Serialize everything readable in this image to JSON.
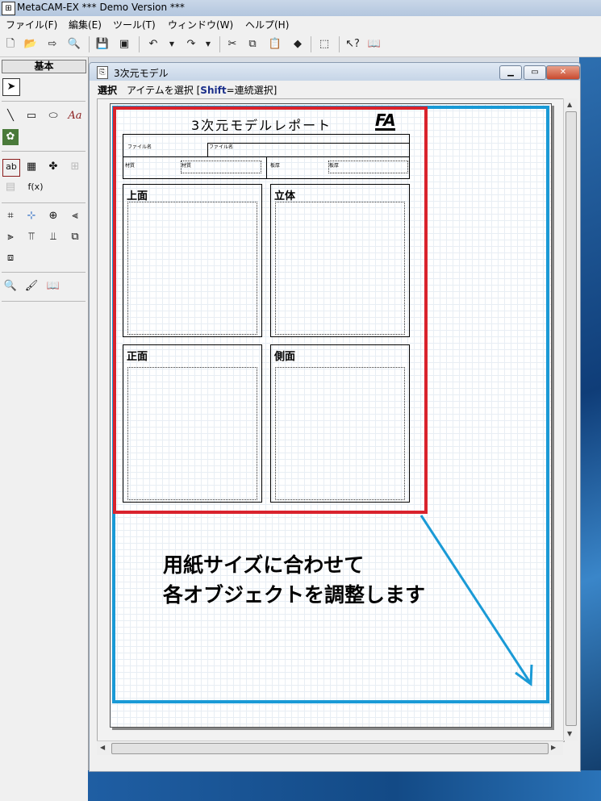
{
  "app": {
    "title": "MetaCAM-EX *** Demo Version ***"
  },
  "menu": [
    "ファイル(F)",
    "編集(E)",
    "ツール(T)",
    "ウィンドウ(W)",
    "ヘルプ(H)"
  ],
  "toolbar_icons": [
    "new-file-icon",
    "open-folder-icon",
    "export-icon",
    "print-preview-icon",
    "save-icon",
    "save-all-icon",
    "undo-icon",
    "undo-dropdown-icon",
    "redo-icon",
    "redo-dropdown-icon",
    "cut-icon",
    "copy-icon",
    "paste-icon",
    "eraser-icon",
    "zoom-window-icon",
    "help-cursor-icon",
    "manual-icon"
  ],
  "palette": {
    "header": "基本",
    "text_tool_label": "Aa",
    "formula_label": "f(x)",
    "text_field_label": "ab"
  },
  "document": {
    "title": "3次元モデル",
    "status_mode": "選択",
    "status_text": "アイテムを選択 [",
    "status_key": "Shift",
    "status_suffix": "=連続選択]"
  },
  "report": {
    "heading": "3次元モデルレポート",
    "logo": "FA",
    "file_name_label": "ファイル名",
    "file_name_value": "ファイル名",
    "material_label": "材質",
    "material_value": "材質",
    "units_label": "板厚",
    "units_value": "板厚",
    "top_view": "上面",
    "iso_view": "立体",
    "front_view": "正面",
    "side_view": "側面"
  },
  "annotation": {
    "line1": "用紙サイズに合わせて",
    "line2": "各オブジェクトを調整します"
  },
  "colors": {
    "red_frame": "#d9232d",
    "blue_frame": "#1a9ad6"
  }
}
